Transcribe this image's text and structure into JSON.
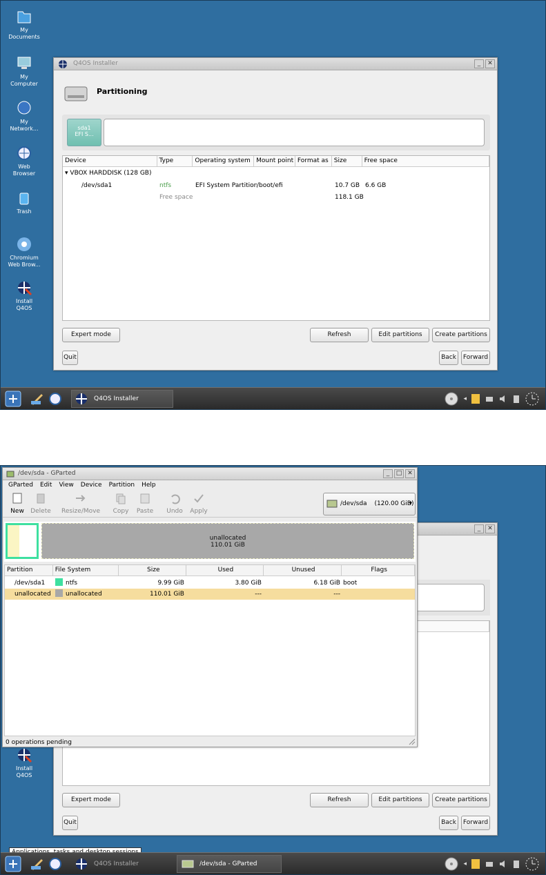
{
  "desktop": {
    "icons": [
      "My\nDocuments",
      "My\nComputer",
      "My\nNetwork...",
      "Web\nBrowser",
      "Trash",
      "Chromium\nWeb Brow...",
      "Install\nQ4OS"
    ],
    "icon_labels": [
      {
        "line1": "My",
        "line2": "Documents"
      },
      {
        "line1": "My",
        "line2": "Computer"
      },
      {
        "line1": "My",
        "line2": "Network..."
      },
      {
        "line1": "Web",
        "line2": "Browser"
      },
      {
        "line1": "Trash",
        "line2": ""
      },
      {
        "line1": "Chromium",
        "line2": "Web Brow..."
      },
      {
        "line1": "Install",
        "line2": "Q4OS"
      }
    ],
    "install_line1": "Install",
    "install_line2": "Q4OS"
  },
  "installer": {
    "title": "Q4OS Installer",
    "heading": "Partitioning",
    "seg_name": "sda1",
    "seg_sub": "EFI S...",
    "columns": [
      "Device",
      "Type",
      "Operating system",
      "Mount point",
      "Format as",
      "Size",
      "Free space"
    ],
    "disk": "VBOX HARDDISK (128 GB)",
    "rows": [
      {
        "device": "/dev/sda1",
        "type": "ntfs",
        "os": "EFI System Partition",
        "mount": "/boot/efi",
        "format": "",
        "size": "10.7 GB",
        "free": "6.6 GB"
      },
      {
        "device": "",
        "type": "Free space",
        "os": "",
        "mount": "",
        "format": "",
        "size": "118.1 GB",
        "free": ""
      }
    ],
    "buttons": {
      "expert": "Expert mode",
      "refresh": "Refresh",
      "edit": "Edit partitions",
      "create": "Create partitions",
      "quit": "Quit",
      "back": "Back",
      "forward": "Forward"
    }
  },
  "taskbar": {
    "task1": "Q4OS Installer",
    "task2": "/dev/sda - GParted",
    "tooltip": "Applications, tasks and desktop sessions"
  },
  "gparted": {
    "title": "/dev/sda - GParted",
    "menu": [
      "GParted",
      "Edit",
      "View",
      "Device",
      "Partition",
      "Help"
    ],
    "tools": [
      "New",
      "Delete",
      "Resize/Move",
      "Copy",
      "Paste",
      "Undo",
      "Apply"
    ],
    "device_name": "/dev/sda",
    "device_size": "(120.00 GiB)",
    "unalloc_label": "unallocated",
    "unalloc_size": "110.01 GiB",
    "columns": [
      "Partition",
      "File System",
      "Size",
      "Used",
      "Unused",
      "Flags"
    ],
    "rows": [
      {
        "partition": "/dev/sda1",
        "fs": "ntfs",
        "size": "9.99 GiB",
        "used": "3.80 GiB",
        "unused": "6.18 GiB",
        "flags": "boot",
        "color": "#3ee0a0"
      },
      {
        "partition": "unallocated",
        "fs": "unallocated",
        "size": "110.01 GiB",
        "used": "---",
        "unused": "---",
        "flags": "",
        "color": "#a8a8a8"
      }
    ],
    "status": "0 operations pending"
  },
  "colors": {
    "desktop": "#2f6ea0",
    "selection": "#f6dd9e",
    "ntfs": "#3ee0a0"
  }
}
